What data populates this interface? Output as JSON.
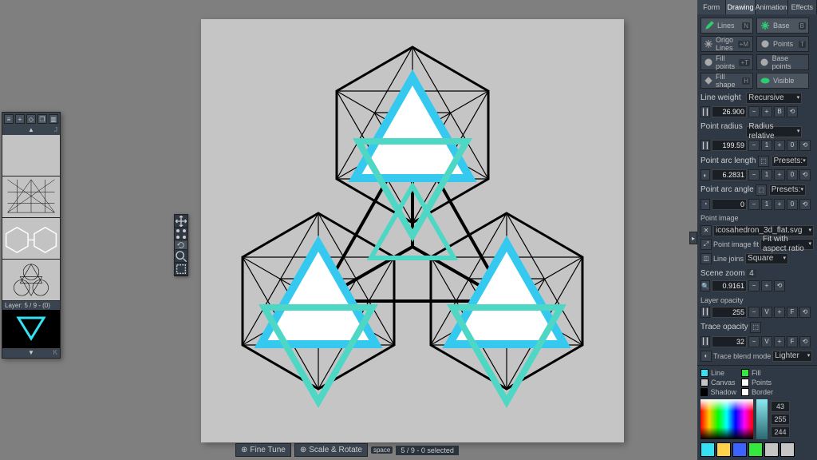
{
  "tabs": [
    "Form",
    "Drawing",
    "Animation",
    "Effects"
  ],
  "active_tab": 1,
  "toggles": {
    "lines": {
      "label": "Lines",
      "hotkey": "N",
      "on": true,
      "green": true
    },
    "base": {
      "label": "Base",
      "hotkey": "B",
      "on": true,
      "green": true
    },
    "origolines": {
      "label": "Origo Lines",
      "hotkey": "+M",
      "on": false
    },
    "points": {
      "label": "Points",
      "hotkey": "T",
      "on": false
    },
    "fillpoints": {
      "label": "Fill points",
      "hotkey": "+T",
      "on": false
    },
    "basepoints": {
      "label": "Base points",
      "hotkey": "",
      "on": false
    },
    "fillshape": {
      "label": "Fill shape",
      "hotkey": "H",
      "on": false
    },
    "visible": {
      "label": "Visible",
      "hotkey": "",
      "on": true,
      "green": true
    }
  },
  "line_weight": {
    "label": "Line weight",
    "mode": "Recursive",
    "value": "26.900"
  },
  "point_radius": {
    "label": "Point radius",
    "mode": "Radius relative",
    "value": "199.59"
  },
  "point_arc_len": {
    "label": "Point arc length",
    "preset": "Presets:",
    "value": "6.2831"
  },
  "point_arc_ang": {
    "label": "Point arc angle",
    "preset": "Presets:",
    "value": "0"
  },
  "point_image": {
    "label": "Point image",
    "file": "icosahedron_3d_flat.svg"
  },
  "point_image_fit": {
    "label": "Point image fit",
    "value": "Fit with aspect ratio"
  },
  "line_joins": {
    "label": "Line joins",
    "value": "Square"
  },
  "scene_zoom": {
    "label": "Scene zoom",
    "hotkey": "4",
    "value": "0.9161"
  },
  "layer_opacity": {
    "label": "Layer opacity",
    "value": "255"
  },
  "trace_opacity": {
    "label": "Trace opacity",
    "value": "32"
  },
  "trace_blend": {
    "label": "Trace blend mode",
    "value": "Lighter"
  },
  "color_props": {
    "items": [
      {
        "name": "Line",
        "color": "#35e2f3"
      },
      {
        "name": "Fill",
        "color": "#35e93c"
      },
      {
        "name": "Canvas",
        "color": "#c5c5c5"
      },
      {
        "name": "Points",
        "color": "#ffffff"
      },
      {
        "name": "Shadow",
        "color": "#000000"
      },
      {
        "name": "Border",
        "color": "#ffffff"
      }
    ],
    "rgb": [
      "43",
      "255",
      "244"
    ],
    "palette": [
      "#35e2f3",
      "#ffd24a",
      "#3a63ff",
      "#35e93c",
      "#c5c5c5",
      "#c5c5c5"
    ]
  },
  "layers": {
    "label": "Layer: 5 / 9 - (0)",
    "up_hotkey": "J",
    "down_hotkey": "K"
  },
  "bottom": {
    "fine": "Fine Tune",
    "scale": "Scale & Rotate",
    "space": "space",
    "sel": "5 / 9 - 0 selected"
  }
}
